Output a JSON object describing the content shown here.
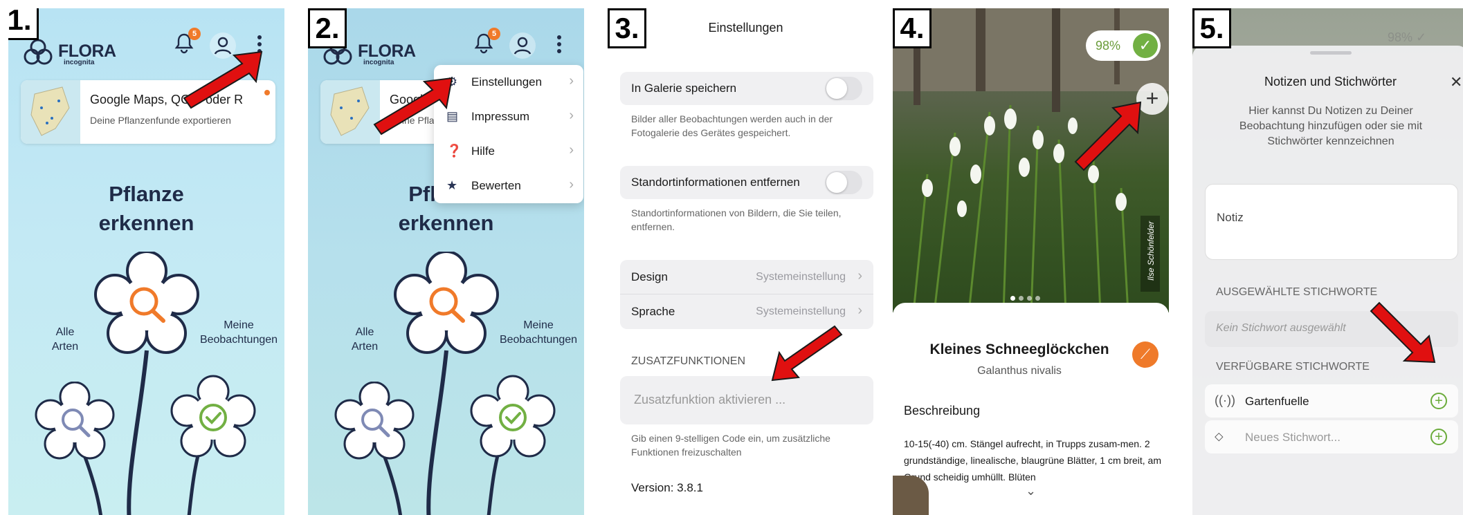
{
  "steps": [
    "1.",
    "2.",
    "3.",
    "4.",
    "5."
  ],
  "home": {
    "logo_title": "FLORA",
    "logo_sub": "incognita",
    "notification_count": "5",
    "card_title": "Google Maps, QGIS oder R",
    "card_sub": "Deine Pflanzenfunde exportieren",
    "hero_line1": "Pflanze",
    "hero_line2": "erkennen",
    "left_label_1": "Alle",
    "left_label_2": "Arten",
    "right_label_1": "Meine",
    "right_label_2": "Beobachtungen",
    "icons": [
      "bell-icon",
      "user-icon",
      "more-vertical-icon"
    ],
    "colors": {
      "accent_orange": "#f07a2a",
      "navy": "#1f2b48",
      "green": "#72b043"
    }
  },
  "menu": {
    "items": [
      {
        "label": "Einstellungen",
        "icon": "gear-icon"
      },
      {
        "label": "Impressum",
        "icon": "document-icon"
      },
      {
        "label": "Hilfe",
        "icon": "help-icon"
      },
      {
        "label": "Bewerten",
        "icon": "star-icon"
      }
    ]
  },
  "settings": {
    "title": "Einstellungen",
    "gallery_label": "In Galerie speichern",
    "gallery_note": "Bilder aller Beobachtungen werden auch in der Fotogalerie des Gerätes gespeichert.",
    "location_label": "Standortinformationen entfernen",
    "location_note": "Standortinformationen von Bildern, die Sie teilen, entfernen.",
    "design_label": "Design",
    "design_value": "Systemeinstellung",
    "language_label": "Sprache",
    "language_value": "Systemeinstellung",
    "extra_section": "ZUSATZFUNKTIONEN",
    "extra_placeholder": "Zusatzfunktion aktivieren ...",
    "extra_note": "Gib einen 9-stelligen Code ein, um zusätzliche Funktionen freizuschalten",
    "version": "Version: 3.8.1"
  },
  "detail": {
    "confidence": "98%",
    "photo_credit": "Ilse Schönfelder",
    "name": "Kleines Schneeglöckchen",
    "latin": "Galanthus nivalis",
    "desc_heading": "Beschreibung",
    "desc_text": "10-15(-40) cm. Stängel aufrecht, in Trupps zusam-men. 2 grundständige, linealische, blaugrüne Blätter, 1 cm breit, am Grund scheidig umhüllt. Blüten"
  },
  "notes": {
    "title": "Notizen und Stichwörter",
    "intro": "Hier kannst Du Notizen zu Deiner Beobachtung hinzufügen oder sie mit Stichwörter kennzeichnen",
    "note_placeholder": "Notiz",
    "selected_section": "AUSGEWÄHLTE STICHWORTE",
    "selected_empty": "Kein Stichwort ausgewählt",
    "available_section": "VERFÜGBARE STICHWORTE",
    "tag_1": "Gartenfuelle",
    "new_tag_placeholder": "Neues Stichwort..."
  }
}
